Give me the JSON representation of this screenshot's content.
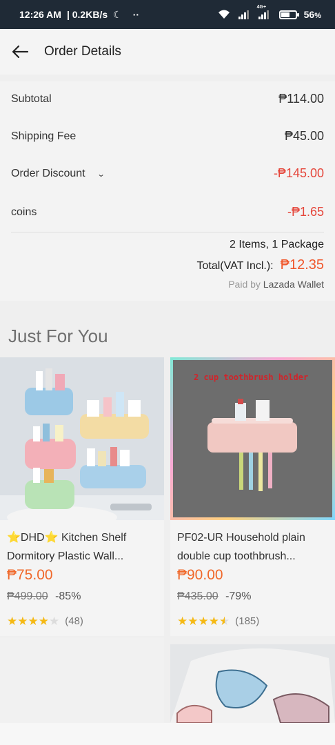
{
  "status_bar": {
    "time": "12:26 AM",
    "speed": "| 0.2KB/s",
    "dots": "··",
    "battery": "56",
    "battery_unit": "%",
    "network_tag": "4G+"
  },
  "header": {
    "title": "Order Details"
  },
  "summary": {
    "subtotal_label": "Subtotal",
    "subtotal_value": "₱114.00",
    "shipping_label": "Shipping Fee",
    "shipping_value": "₱45.00",
    "discount_label": "Order Discount",
    "discount_value": "-₱145.00",
    "coins_label": "coins",
    "coins_value": "-₱1.65",
    "items_text": "2 Items, 1 Package",
    "total_label": "Total(VAT Incl.):",
    "total_value": "₱12.35",
    "paid_prefix": "Paid by",
    "paid_method": "Lazada Wallet"
  },
  "just_for_you": {
    "title": "Just For You",
    "products": [
      {
        "title": "⭐DHD⭐ Kitchen Shelf Dormitory Plastic Wall...",
        "price": "₱75.00",
        "old_price": "₱499.00",
        "discount": "-85%",
        "rating": 4,
        "reviews": "(48)"
      },
      {
        "title": "PF02-UR Household plain double cup toothbrush...",
        "price": "₱90.00",
        "old_price": "₱435.00",
        "discount": "-79%",
        "rating": 4.5,
        "reviews": "(185)",
        "image_label": "2 cup toothbrush holder"
      }
    ]
  },
  "colors": {
    "accent_orange": "#f0682a",
    "negative_red": "#e5463b",
    "star": "#f5b914",
    "status_bar_bg": "#1f2a36"
  }
}
